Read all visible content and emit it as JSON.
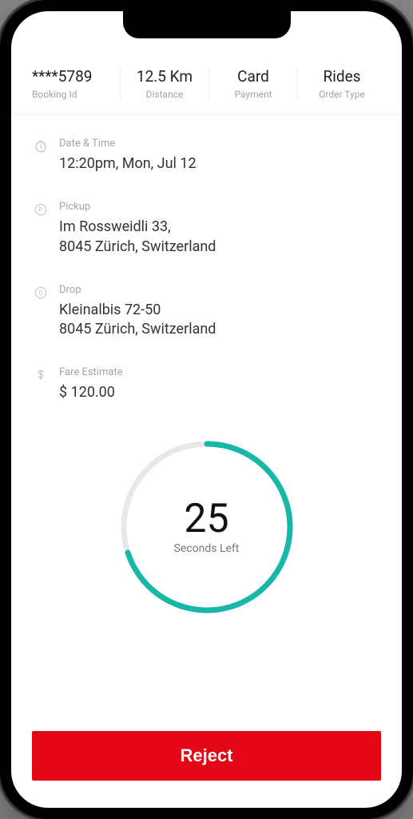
{
  "stats": [
    {
      "value": "****5789",
      "label": "Booking Id"
    },
    {
      "value": "12.5 Km",
      "label": "Distance"
    },
    {
      "value": "Card",
      "label": "Payment"
    },
    {
      "value": "Rides",
      "label": "Order Type"
    }
  ],
  "datetime": {
    "label": "Date & Time",
    "value": "12:20pm, Mon, Jul 12"
  },
  "pickup": {
    "label": "Pickup",
    "value": "Im Rossweidli 33,\n8045 Zürich, Switzerland"
  },
  "drop": {
    "label": "Drop",
    "value": "Kleinalbis 72-50\n8045 Zürich, Switzerland"
  },
  "fare": {
    "label": "Fare Estimate",
    "value": "$ 120.00"
  },
  "timer": {
    "seconds": "25",
    "label": "Seconds Left",
    "percent": 70
  },
  "reject_label": "Reject",
  "colors": {
    "accent": "#18b8a8",
    "danger": "#e30614"
  }
}
